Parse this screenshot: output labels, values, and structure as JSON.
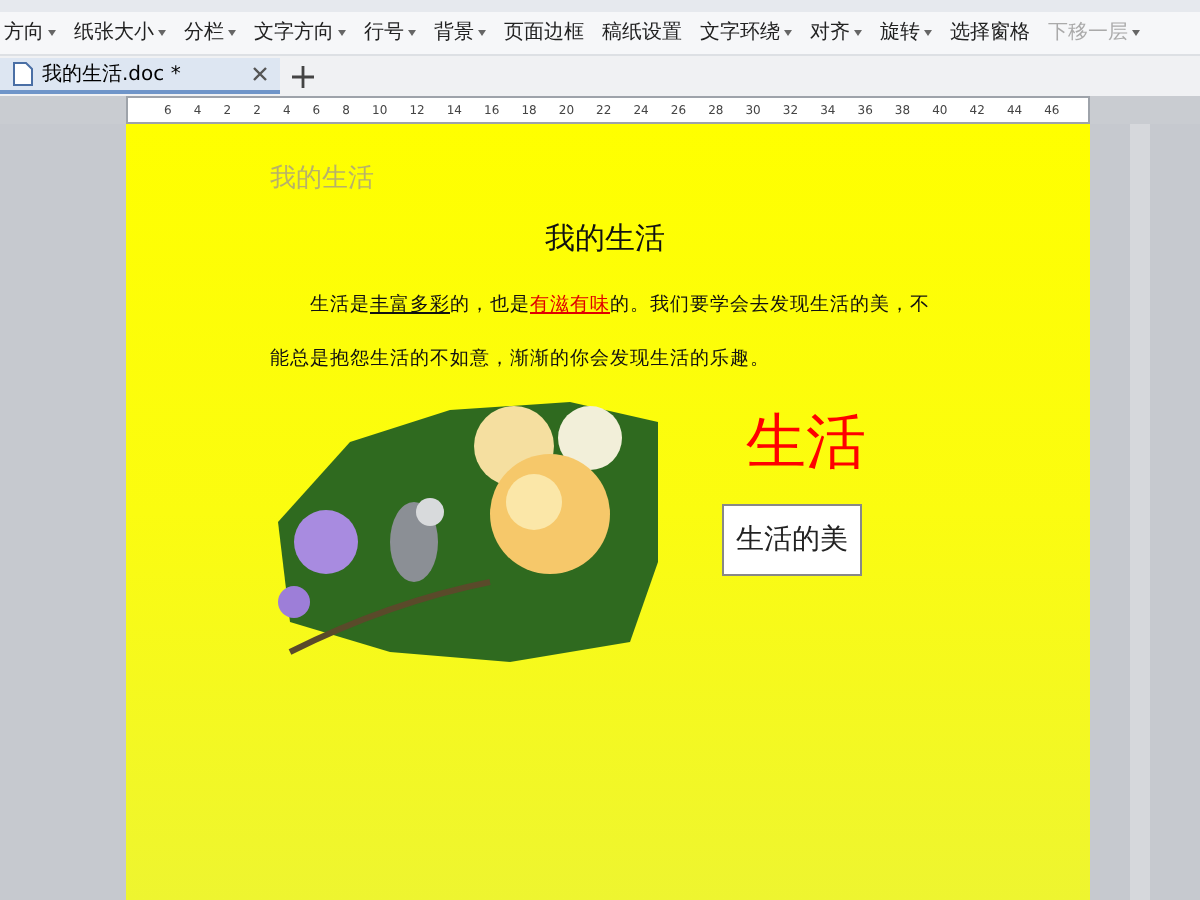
{
  "toolbar": {
    "items": [
      {
        "label": "方向",
        "has_menu": true,
        "disabled": false
      },
      {
        "label": "纸张大小",
        "has_menu": true,
        "disabled": false
      },
      {
        "label": "分栏",
        "has_menu": true,
        "disabled": false
      },
      {
        "label": "文字方向",
        "has_menu": true,
        "disabled": false
      },
      {
        "label": "行号",
        "has_menu": true,
        "disabled": false
      },
      {
        "label": "背景",
        "has_menu": true,
        "disabled": false
      },
      {
        "label": "页面边框",
        "has_menu": false,
        "disabled": false
      },
      {
        "label": "稿纸设置",
        "has_menu": false,
        "disabled": false
      },
      {
        "label": "文字环绕",
        "has_menu": true,
        "disabled": false
      },
      {
        "label": "对齐",
        "has_menu": true,
        "disabled": false
      },
      {
        "label": "旋转",
        "has_menu": true,
        "disabled": false
      },
      {
        "label": "选择窗格",
        "has_menu": false,
        "disabled": false
      },
      {
        "label": "下移一层",
        "has_menu": true,
        "disabled": true
      }
    ]
  },
  "tabs": [
    {
      "label": "我的生活.doc *",
      "selected": true
    }
  ],
  "ruler": {
    "labels": [
      "6",
      "4",
      "2",
      "2",
      "4",
      "6",
      "8",
      "10",
      "12",
      "14",
      "16",
      "18",
      "20",
      "22",
      "24",
      "26",
      "28",
      "30",
      "32",
      "34",
      "36",
      "38",
      "40",
      "42",
      "44",
      "46"
    ]
  },
  "document": {
    "header": "我的生活",
    "title": "我的生活",
    "paragraph": [
      {
        "text": "生活是",
        "kind": "plain"
      },
      {
        "text": "丰富多彩",
        "kind": "underline"
      },
      {
        "text": "的，也是",
        "kind": "plain"
      },
      {
        "text": "有滋有味",
        "kind": "red-underline"
      },
      {
        "text": "的。我们要学会去发现生活的美，不能总是抱怨生活的不如意，渐渐的你会发现生活的乐趣。",
        "kind": "plain"
      }
    ],
    "wordart": "生活",
    "text_box": "生活的美"
  }
}
